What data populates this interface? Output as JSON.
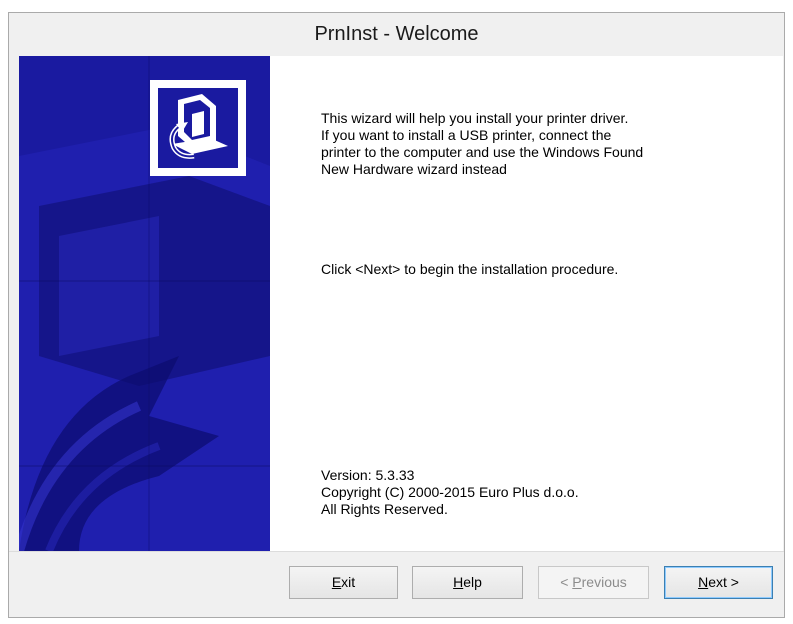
{
  "window": {
    "title": "PrnInst - Welcome"
  },
  "intro": {
    "lines": [
      "This wizard will help you install your printer driver.",
      "If you want to install a USB printer, connect the",
      "printer to the computer and use the Windows Found",
      "New Hardware wizard instead"
    ]
  },
  "instruction": "Click <Next> to begin the installation procedure.",
  "about": {
    "version": "Version: 5.3.33",
    "copyright": "Copyright (C) 2000-2015 Euro Plus d.o.o.",
    "rights": "All Rights Reserved."
  },
  "buttons": {
    "exit": {
      "mnemonic": "E",
      "rest": "xit"
    },
    "help": {
      "mnemonic": "H",
      "rest": "elp"
    },
    "previous": {
      "prefix": "< ",
      "mnemonic": "P",
      "rest": "revious"
    },
    "next": {
      "mnemonic": "N",
      "rest": "ext >"
    }
  },
  "colors": {
    "banner": "#1a1aa0",
    "banner_dark": "#0c0c6e",
    "banner_light": "#2a2ac0"
  },
  "icons": {
    "logo": "printer-install-icon"
  }
}
